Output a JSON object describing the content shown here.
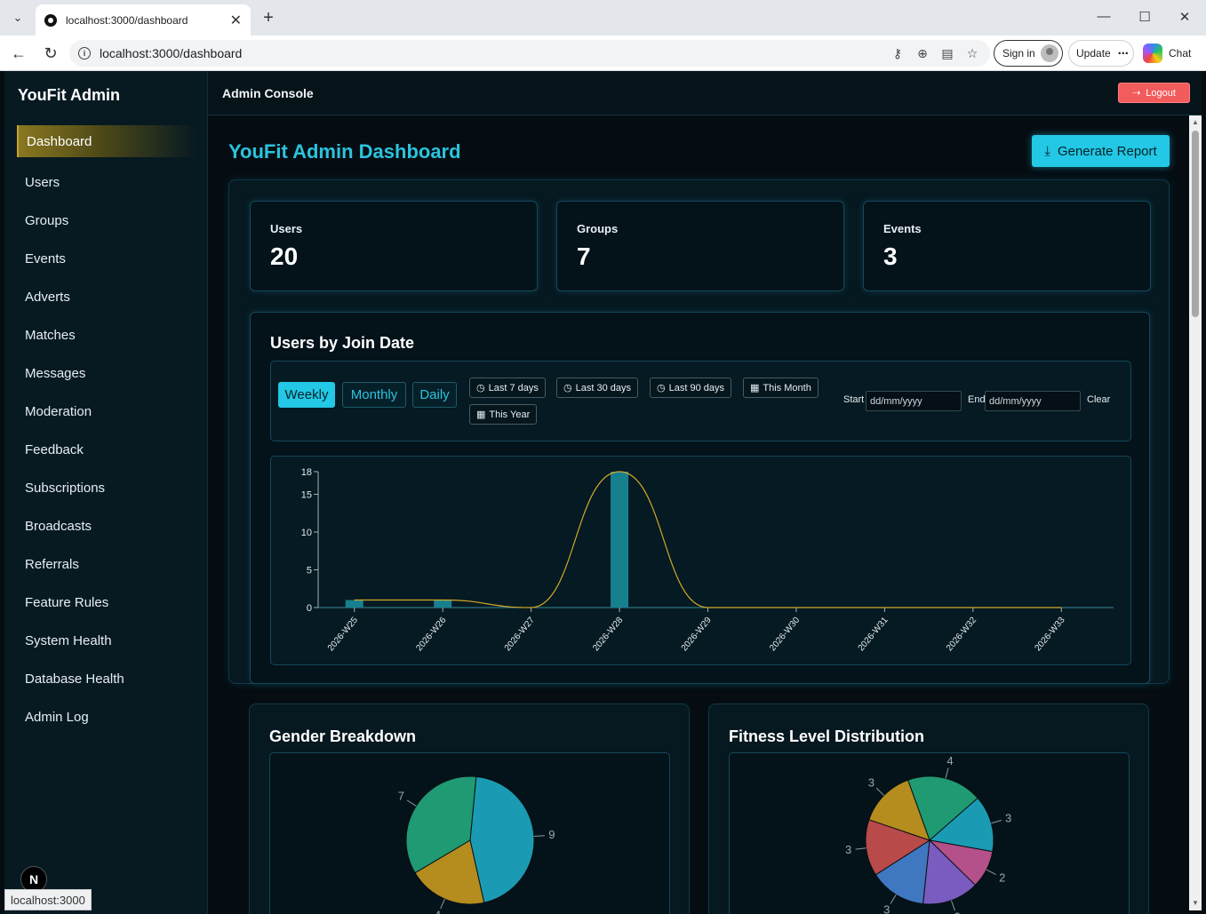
{
  "browser": {
    "tab_title": "localhost:3000/dashboard",
    "url": "localhost:3000/dashboard",
    "sign_in_label": "Sign in",
    "update_label": "Update",
    "chat_label": "Chat",
    "status_url": "localhost:3000"
  },
  "sidebar": {
    "brand": "YouFit Admin",
    "items": [
      {
        "label": "Dashboard"
      },
      {
        "label": "Users"
      },
      {
        "label": "Groups"
      },
      {
        "label": "Events"
      },
      {
        "label": "Adverts"
      },
      {
        "label": "Matches"
      },
      {
        "label": "Messages"
      },
      {
        "label": "Moderation"
      },
      {
        "label": "Feedback"
      },
      {
        "label": "Subscriptions"
      },
      {
        "label": "Broadcasts"
      },
      {
        "label": "Referrals"
      },
      {
        "label": "Feature Rules"
      },
      {
        "label": "System Health"
      },
      {
        "label": "Database Health"
      },
      {
        "label": "Admin Log"
      }
    ],
    "active_index": 0,
    "badge": "N"
  },
  "topbar": {
    "title": "Admin Console",
    "logout_label": "Logout"
  },
  "main": {
    "title": "YouFit Admin Dashboard",
    "generate_report_label": "Generate Report",
    "stats": [
      {
        "label": "Users",
        "value": "20"
      },
      {
        "label": "Groups",
        "value": "7"
      },
      {
        "label": "Events",
        "value": "3"
      }
    ],
    "join_chart": {
      "title": "Users by Join Date",
      "granularity": [
        "Weekly",
        "Monthly",
        "Daily"
      ],
      "active_granularity": "Weekly",
      "ranges": [
        "Last 7 days",
        "Last 30 days",
        "Last 90 days",
        "This Month",
        "This Year"
      ],
      "start_label": "Start",
      "end_label": "End",
      "date_placeholder": "dd/mm/yyyy",
      "clear_label": "Clear"
    },
    "gender_title": "Gender Breakdown",
    "fitness_title": "Fitness Level Distribution"
  },
  "colors": {
    "accent": "#22c8e5",
    "bar": "#16808f",
    "line": "#d4a82a",
    "logout": "#f25c5c"
  },
  "chart_data": [
    {
      "type": "bar",
      "categories": [
        "2026-W25",
        "2026-W26",
        "2026-W27",
        "2026-W28",
        "2026-W29",
        "2026-W30",
        "2026-W31",
        "2026-W32",
        "2026-W33"
      ],
      "values": [
        1,
        1,
        0,
        18,
        0,
        0,
        0,
        0,
        0
      ],
      "yticks": [
        0,
        5,
        10,
        15,
        18
      ],
      "ylim": [
        0,
        18
      ],
      "overlay": "smoothed-line"
    },
    {
      "type": "pie",
      "slices": [
        {
          "value": 9,
          "color": "#1a9bb3"
        },
        {
          "value": 4,
          "color": "#b58d1e"
        },
        {
          "value": 7,
          "color": "#1f9a72"
        }
      ]
    },
    {
      "type": "pie",
      "slices": [
        {
          "value": 4,
          "color": "#1f9a72"
        },
        {
          "value": 3,
          "color": "#1a9bb3"
        },
        {
          "value": 2,
          "color": "#b4508a"
        },
        {
          "value": 3,
          "color": "#7a5cc0"
        },
        {
          "value": 3,
          "color": "#3f78c0"
        },
        {
          "value": 3,
          "color": "#b84a4a"
        },
        {
          "value": 3,
          "color": "#b58d1e"
        }
      ]
    }
  ]
}
